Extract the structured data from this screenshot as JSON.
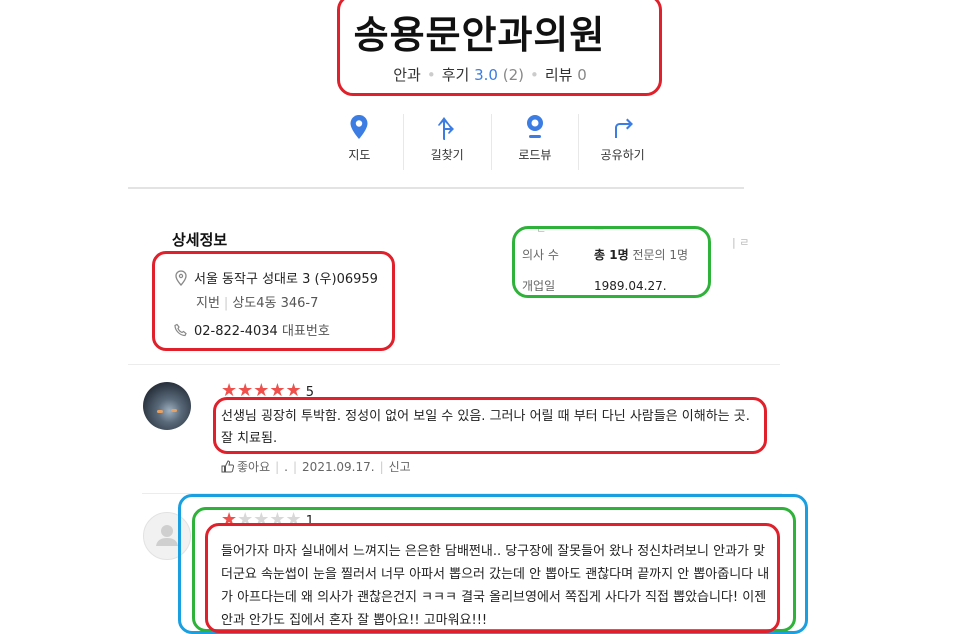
{
  "header": {
    "title": "송용문안과의원",
    "category": "안과",
    "review_label": "후기",
    "rating": "3.0",
    "rating_count": "(2)",
    "blog_review_label": "리뷰",
    "blog_review_count": "0"
  },
  "actions": [
    {
      "label": "지도",
      "icon": "map-pin-icon"
    },
    {
      "label": "길찾기",
      "icon": "directions-icon"
    },
    {
      "label": "로드뷰",
      "icon": "roadview-icon"
    },
    {
      "label": "공유하기",
      "icon": "share-icon"
    }
  ],
  "details": {
    "section_title": "상세정보",
    "address": "서울 동작구 성대로 3 (우)06959",
    "jibun_label": "지번",
    "jibun": "상도4동 346-7",
    "phone": "02-822-4034",
    "phone_label": "대표번호",
    "doctor_label": "의사 수",
    "doctor_value": "총 1명",
    "doctor_sub": "전문의 1명",
    "open_label": "개업일",
    "open_value": "1989.04.27."
  },
  "reviews": [
    {
      "stars": 5,
      "score": "5",
      "text": "선생님 굉장히 투박함. 정성이 없어 보일 수 있음. 그러나 어릴 때 부터 다닌 사람들은 이해하는 곳. 잘 치료됨.",
      "like_label": "좋아요",
      "like_count": ".",
      "date": "2021.09.17.",
      "report_label": "신고"
    },
    {
      "stars": 1,
      "score": "1",
      "text": "들어가자 마자 실내에서 느껴지는 은은한 담배쩐내.. 당구장에 잘못들어 왔나 정신차려보니 안과가 맞더군요 속눈썹이 눈을 찔러서 너무 아파서 뽑으러 갔는데 안 뽑아도 괜찮다며 끝까지 안 뽑아줍니다 내가 아프다는데 왜 의사가 괜찮은건지 ㅋㅋㅋ 결국 올리브영에서 쪽집게 사다가 직접 뽑았습니다! 이젠 안과 안가도 집에서 혼자 잘 뽑아요!! 고마워요!!!"
    }
  ],
  "colors": {
    "accent_blue": "#3c7de3",
    "star_red": "#f0504c",
    "box_red": "#e0202a",
    "box_green": "#2fb23a",
    "box_cyan": "#1a9fe0"
  }
}
